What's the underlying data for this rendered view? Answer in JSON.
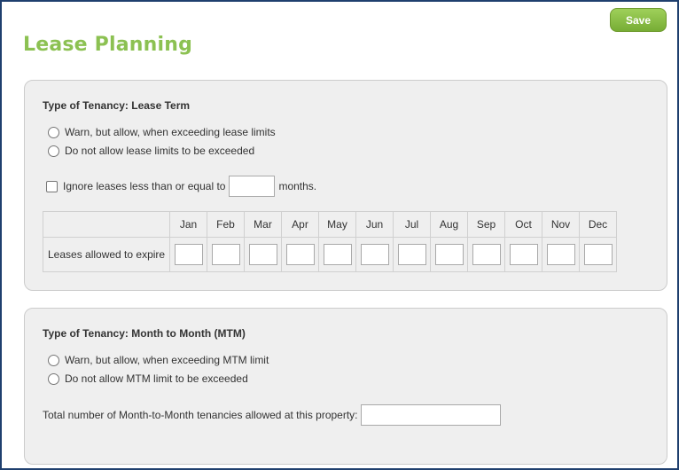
{
  "header": {
    "title": "Lease Planning",
    "save_label": "Save"
  },
  "lease_term": {
    "title": "Type of Tenancy: Lease Term",
    "options": [
      "Warn, but allow, when exceeding lease limits",
      "Do not allow lease limits to be exceeded"
    ],
    "ignore_prefix": "Ignore leases less than or equal to",
    "ignore_value": "",
    "ignore_suffix": "months.",
    "table": {
      "row_label": "Leases allowed to expire",
      "months": [
        "Jan",
        "Feb",
        "Mar",
        "Apr",
        "May",
        "Jun",
        "Jul",
        "Aug",
        "Sep",
        "Oct",
        "Nov",
        "Dec"
      ],
      "values": [
        "",
        "",
        "",
        "",
        "",
        "",
        "",
        "",
        "",
        "",
        "",
        ""
      ]
    }
  },
  "mtm": {
    "title": "Type of Tenancy: Month to Month (MTM)",
    "options": [
      "Warn, but allow, when exceeding MTM limit",
      "Do not allow MTM limit to be exceeded"
    ],
    "total_label": "Total number of Month-to-Month tenancies allowed at this property:",
    "total_value": ""
  },
  "colors": {
    "accent": "#8cc152",
    "button": "#77ad35",
    "frame_border": "#1f3f6e",
    "panel_bg": "#efefef"
  }
}
